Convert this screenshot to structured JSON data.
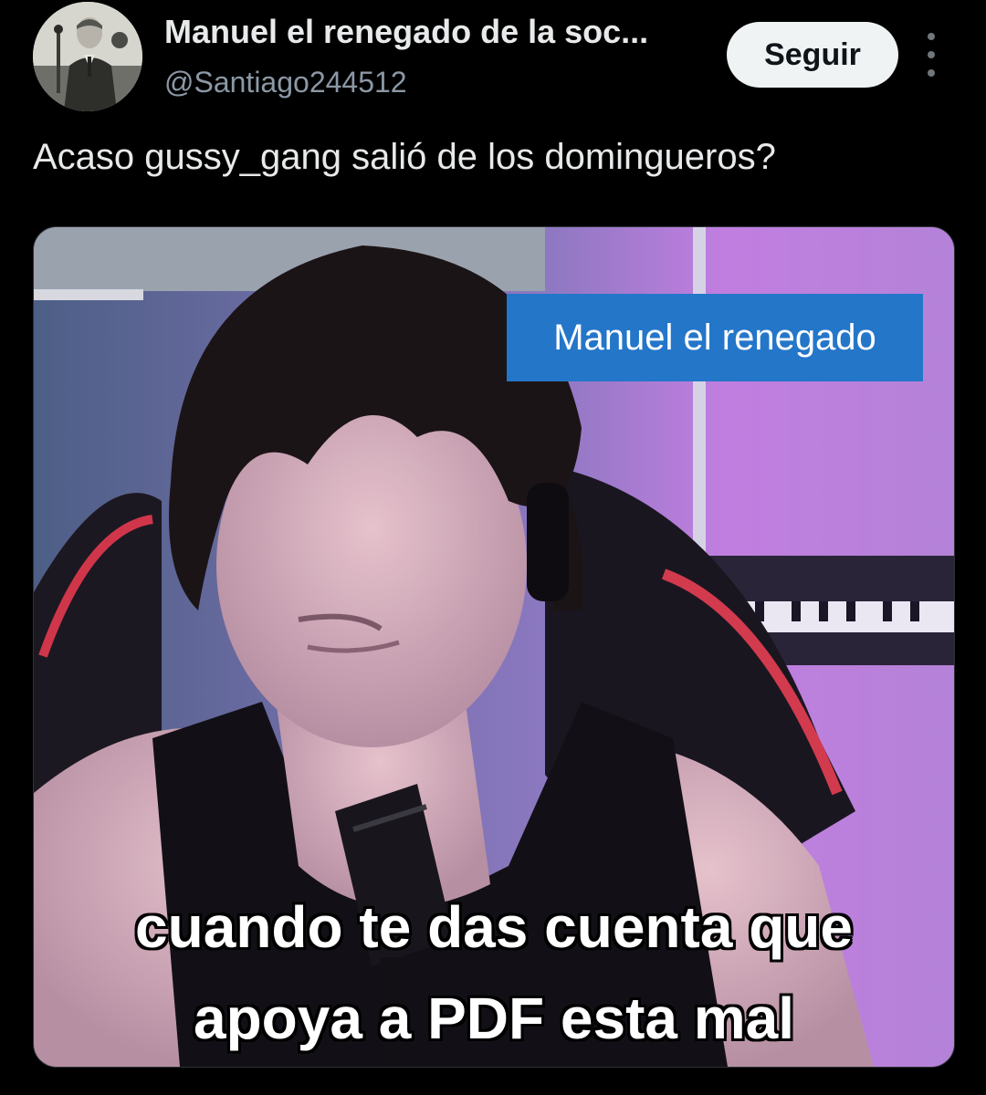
{
  "post": {
    "author": {
      "display_name": "Manuel el renegado de la soc...",
      "handle": "@Santiago244512",
      "avatar_icon": "avatar-photo"
    },
    "follow_label": "Seguir",
    "more_icon": "more-vertical-icon",
    "text": "Acaso gussy_gang salió de los domingueros?",
    "media": {
      "overlay_tag": "Manuel el renegado",
      "caption_line1": "cuando te das cuenta que",
      "caption_line2": "apoya a PDF esta mal"
    }
  },
  "colors": {
    "background": "#000000",
    "text_primary": "#e7e9ea",
    "text_secondary": "#8b98a5",
    "follow_bg": "#eff3f4",
    "tag_blue": "#2476c9"
  }
}
